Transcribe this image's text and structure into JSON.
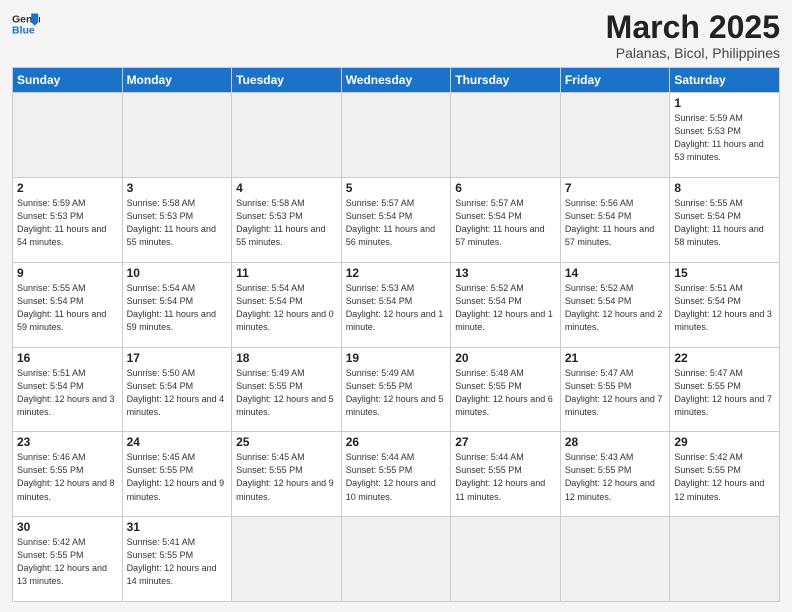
{
  "header": {
    "logo_general": "General",
    "logo_blue": "Blue",
    "month_title": "March 2025",
    "location": "Palanas, Bicol, Philippines"
  },
  "weekdays": [
    "Sunday",
    "Monday",
    "Tuesday",
    "Wednesday",
    "Thursday",
    "Friday",
    "Saturday"
  ],
  "weeks": [
    [
      {
        "day": "",
        "info": ""
      },
      {
        "day": "",
        "info": ""
      },
      {
        "day": "",
        "info": ""
      },
      {
        "day": "",
        "info": ""
      },
      {
        "day": "",
        "info": ""
      },
      {
        "day": "",
        "info": ""
      },
      {
        "day": "1",
        "info": "Sunrise: 5:59 AM\nSunset: 5:53 PM\nDaylight: 11 hours\nand 53 minutes."
      }
    ],
    [
      {
        "day": "2",
        "info": "Sunrise: 5:59 AM\nSunset: 5:53 PM\nDaylight: 11 hours\nand 54 minutes."
      },
      {
        "day": "3",
        "info": "Sunrise: 5:58 AM\nSunset: 5:53 PM\nDaylight: 11 hours\nand 55 minutes."
      },
      {
        "day": "4",
        "info": "Sunrise: 5:58 AM\nSunset: 5:53 PM\nDaylight: 11 hours\nand 55 minutes."
      },
      {
        "day": "5",
        "info": "Sunrise: 5:57 AM\nSunset: 5:54 PM\nDaylight: 11 hours\nand 56 minutes."
      },
      {
        "day": "6",
        "info": "Sunrise: 5:57 AM\nSunset: 5:54 PM\nDaylight: 11 hours\nand 57 minutes."
      },
      {
        "day": "7",
        "info": "Sunrise: 5:56 AM\nSunset: 5:54 PM\nDaylight: 11 hours\nand 57 minutes."
      },
      {
        "day": "8",
        "info": "Sunrise: 5:55 AM\nSunset: 5:54 PM\nDaylight: 11 hours\nand 58 minutes."
      }
    ],
    [
      {
        "day": "9",
        "info": "Sunrise: 5:55 AM\nSunset: 5:54 PM\nDaylight: 11 hours\nand 59 minutes."
      },
      {
        "day": "10",
        "info": "Sunrise: 5:54 AM\nSunset: 5:54 PM\nDaylight: 11 hours\nand 59 minutes."
      },
      {
        "day": "11",
        "info": "Sunrise: 5:54 AM\nSunset: 5:54 PM\nDaylight: 12 hours\nand 0 minutes."
      },
      {
        "day": "12",
        "info": "Sunrise: 5:53 AM\nSunset: 5:54 PM\nDaylight: 12 hours\nand 1 minute."
      },
      {
        "day": "13",
        "info": "Sunrise: 5:52 AM\nSunset: 5:54 PM\nDaylight: 12 hours\nand 1 minute."
      },
      {
        "day": "14",
        "info": "Sunrise: 5:52 AM\nSunset: 5:54 PM\nDaylight: 12 hours\nand 2 minutes."
      },
      {
        "day": "15",
        "info": "Sunrise: 5:51 AM\nSunset: 5:54 PM\nDaylight: 12 hours\nand 3 minutes."
      }
    ],
    [
      {
        "day": "16",
        "info": "Sunrise: 5:51 AM\nSunset: 5:54 PM\nDaylight: 12 hours\nand 3 minutes."
      },
      {
        "day": "17",
        "info": "Sunrise: 5:50 AM\nSunset: 5:54 PM\nDaylight: 12 hours\nand 4 minutes."
      },
      {
        "day": "18",
        "info": "Sunrise: 5:49 AM\nSunset: 5:55 PM\nDaylight: 12 hours\nand 5 minutes."
      },
      {
        "day": "19",
        "info": "Sunrise: 5:49 AM\nSunset: 5:55 PM\nDaylight: 12 hours\nand 5 minutes."
      },
      {
        "day": "20",
        "info": "Sunrise: 5:48 AM\nSunset: 5:55 PM\nDaylight: 12 hours\nand 6 minutes."
      },
      {
        "day": "21",
        "info": "Sunrise: 5:47 AM\nSunset: 5:55 PM\nDaylight: 12 hours\nand 7 minutes."
      },
      {
        "day": "22",
        "info": "Sunrise: 5:47 AM\nSunset: 5:55 PM\nDaylight: 12 hours\nand 7 minutes."
      }
    ],
    [
      {
        "day": "23",
        "info": "Sunrise: 5:46 AM\nSunset: 5:55 PM\nDaylight: 12 hours\nand 8 minutes."
      },
      {
        "day": "24",
        "info": "Sunrise: 5:45 AM\nSunset: 5:55 PM\nDaylight: 12 hours\nand 9 minutes."
      },
      {
        "day": "25",
        "info": "Sunrise: 5:45 AM\nSunset: 5:55 PM\nDaylight: 12 hours\nand 9 minutes."
      },
      {
        "day": "26",
        "info": "Sunrise: 5:44 AM\nSunset: 5:55 PM\nDaylight: 12 hours\nand 10 minutes."
      },
      {
        "day": "27",
        "info": "Sunrise: 5:44 AM\nSunset: 5:55 PM\nDaylight: 12 hours\nand 11 minutes."
      },
      {
        "day": "28",
        "info": "Sunrise: 5:43 AM\nSunset: 5:55 PM\nDaylight: 12 hours\nand 12 minutes."
      },
      {
        "day": "29",
        "info": "Sunrise: 5:42 AM\nSunset: 5:55 PM\nDaylight: 12 hours\nand 12 minutes."
      }
    ],
    [
      {
        "day": "30",
        "info": "Sunrise: 5:42 AM\nSunset: 5:55 PM\nDaylight: 12 hours\nand 13 minutes."
      },
      {
        "day": "31",
        "info": "Sunrise: 5:41 AM\nSunset: 5:55 PM\nDaylight: 12 hours\nand 14 minutes."
      },
      {
        "day": "",
        "info": ""
      },
      {
        "day": "",
        "info": ""
      },
      {
        "day": "",
        "info": ""
      },
      {
        "day": "",
        "info": ""
      },
      {
        "day": "",
        "info": ""
      }
    ]
  ]
}
